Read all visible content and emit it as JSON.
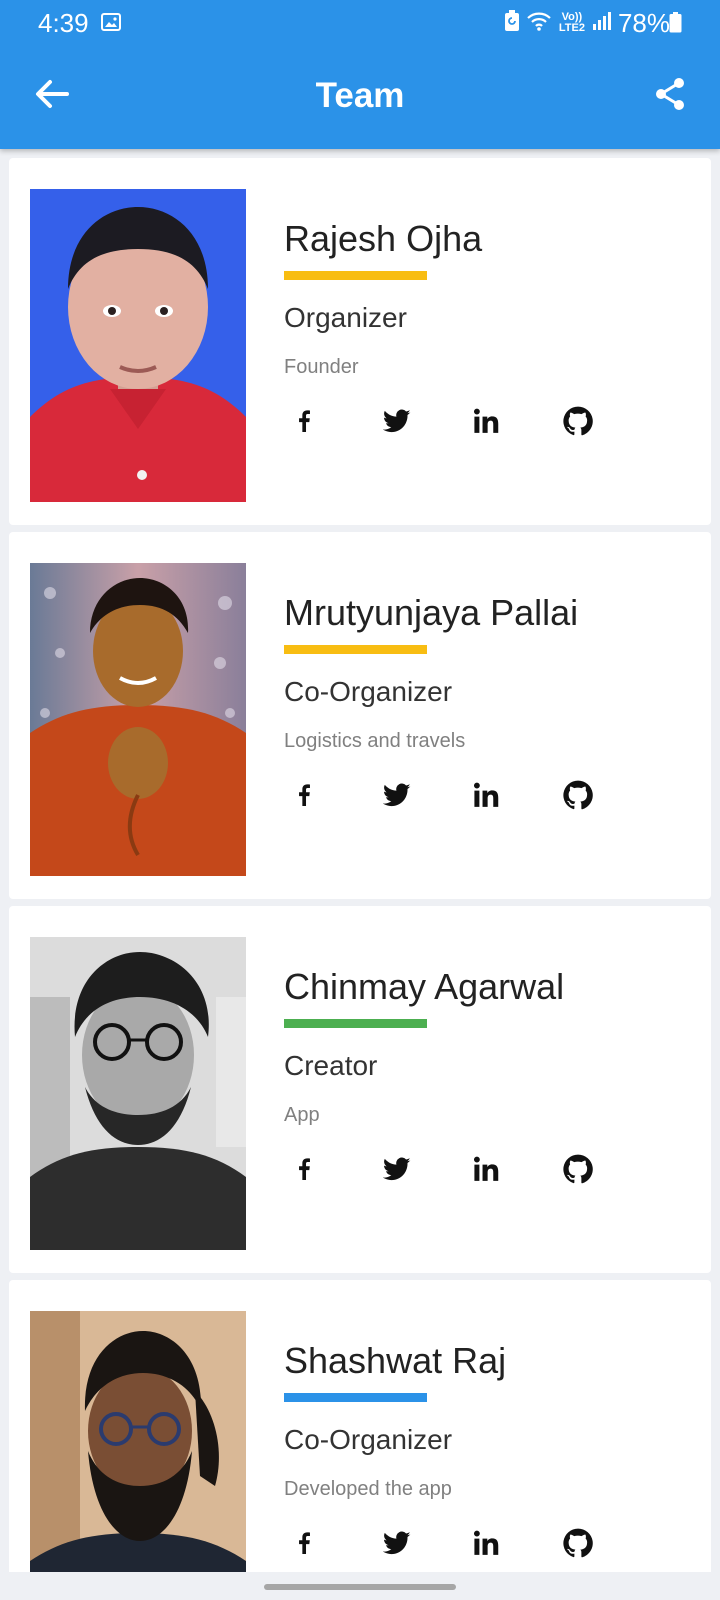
{
  "status_bar": {
    "time": "4:39",
    "network": "Vo)) LTE2",
    "battery": "78%"
  },
  "app_bar": {
    "title": "Team",
    "background_color": "#2b92e8",
    "back_icon": "arrow-left-icon",
    "share_icon": "share-icon"
  },
  "team": [
    {
      "name": "Rajesh Ojha",
      "role": "Organizer",
      "description": "Founder",
      "accent_color": "#f8bd12",
      "photo": "portrait-man-red-shirt-blue-background",
      "socials": [
        "facebook-icon",
        "twitter-icon",
        "linkedin-icon",
        "github-icon"
      ]
    },
    {
      "name": "Mrutyunjaya Pallai",
      "role": "Co-Organizer",
      "description": "Logistics and travels",
      "accent_color": "#f8bd12",
      "photo": "portrait-man-orange-shirt-bokeh",
      "socials": [
        "facebook-icon",
        "twitter-icon",
        "linkedin-icon",
        "github-icon"
      ]
    },
    {
      "name": "Chinmay Agarwal",
      "role": "Creator",
      "description": "App",
      "accent_color": "#4caf50",
      "photo": "portrait-man-glasses-grayscale",
      "socials": [
        "facebook-icon",
        "twitter-icon",
        "linkedin-icon",
        "github-icon"
      ]
    },
    {
      "name": "Shashwat Raj",
      "role": "Co-Organizer",
      "description": "Developed the app",
      "accent_color": "#2b92e8",
      "photo": "portrait-man-beard-glasses",
      "socials": [
        "facebook-icon",
        "twitter-icon",
        "linkedin-icon",
        "github-icon"
      ]
    }
  ]
}
